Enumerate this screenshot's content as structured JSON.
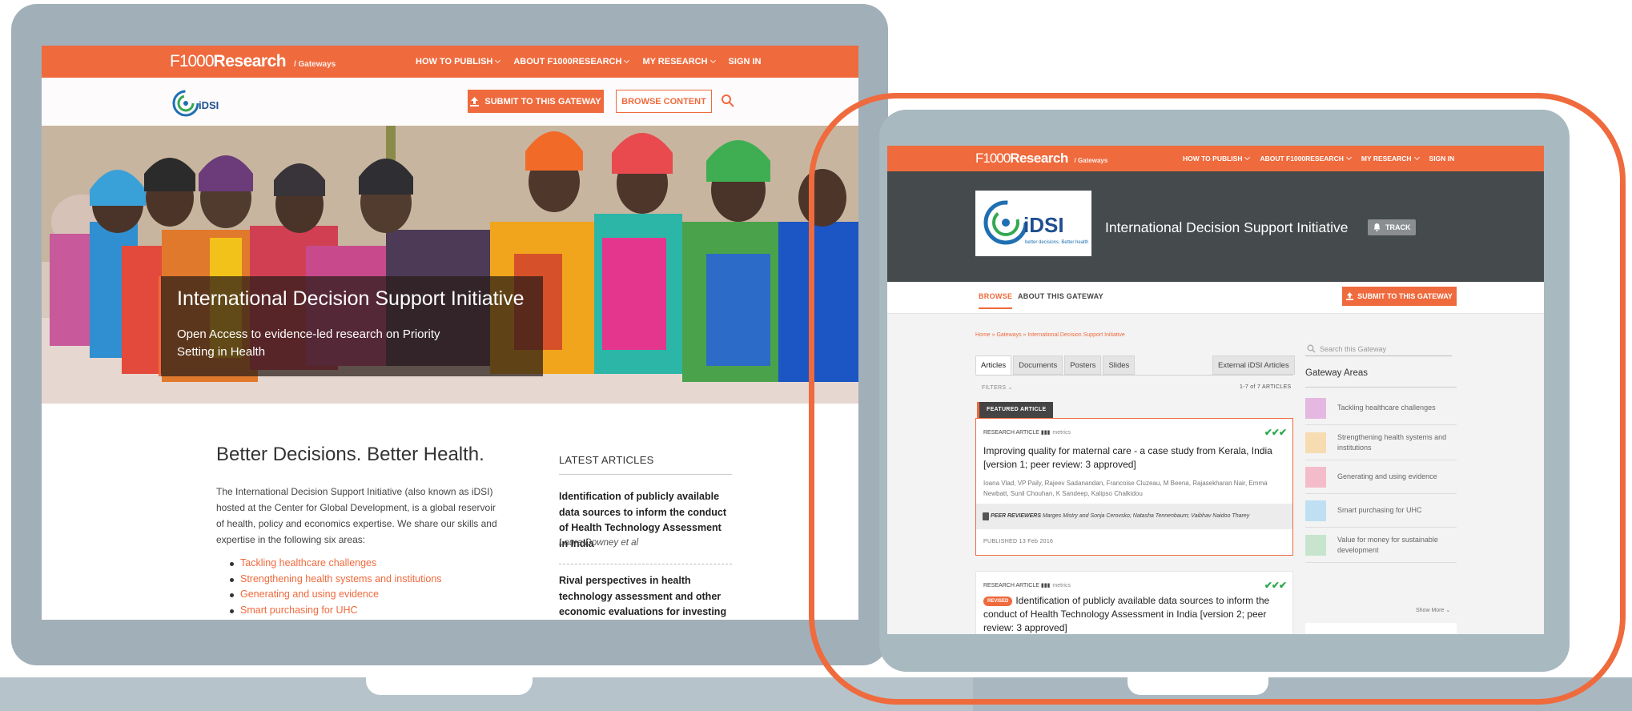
{
  "colors": {
    "brand_orange": "#ef6a3d",
    "dark_banner": "#454a4d",
    "device_gray": "#a1afb8",
    "peer_green": "#29a84a"
  },
  "header": {
    "logo_f1000": "F1000",
    "logo_research": "Research",
    "logo_gateways": "/ Gateways",
    "nav": [
      "HOW TO PUBLISH",
      "ABOUT F1000RESEARCH",
      "MY RESEARCH",
      "SIGN IN"
    ]
  },
  "screen1": {
    "submit_label": "SUBMIT TO THIS GATEWAY",
    "browse_label": "BROWSE CONTENT",
    "hero_title": "International Decision Support Initiative",
    "hero_subtitle": "Open Access to evidence-led research on Priority Setting in Health",
    "section_title": "Better Decisions. Better Health.",
    "intro": "The International Decision Support Initiative (also known as iDSI) hosted at the Center for Global Development, is a global reservoir of health, policy and economics expertise. We share our skills and expertise in the following six areas:",
    "areas": [
      "Tackling healthcare challenges",
      "Strengthening health systems and institutions",
      "Generating and using evidence",
      "Smart purchasing for UHC"
    ],
    "latest_heading": "LATEST ARTICLES",
    "latest": [
      {
        "title": "Identification of publicly available data sources to inform the conduct of Health Technology Assessment in India",
        "authors": "Laura Downey et al"
      },
      {
        "title": "Rival perspectives in health technology assessment and other economic evaluations for investing in global and"
      }
    ]
  },
  "screen2": {
    "logo_text": "iDSI",
    "logo_tagline": "better decisions. Better health",
    "gateway_title": "International Decision Support Initiative",
    "track_label": "TRACK",
    "tab_browse": "BROWSE",
    "tab_about": "ABOUT THIS GATEWAY",
    "submit_label": "SUBMIT TO THIS GATEWAY",
    "breadcrumb": "Home » Gateways » International Decision Support Initiative",
    "filter_tabs": [
      "Articles",
      "Documents",
      "Posters",
      "Slides"
    ],
    "external_tab": "External iDSI Articles",
    "filters_label": "FILTERS",
    "count_label": "1-7 of 7 ARTICLES",
    "featured_label": "FEATURED ARTICLE",
    "card1": {
      "type": "RESEARCH ARTICLE",
      "metrics": "metrics",
      "ticks": "✔✔✔",
      "title": "Improving quality for maternal care - a case study from Kerala, India [version 1; peer review: 3 approved]",
      "authors": "Ioana Vlad, VP Paily, Rajeev Sadanandan, Francoise Cluzeau, M Beena, Rajasekharan Nair, Emma Newbatt, Sunil Chouhan, K Sandeep, Kalipso Chalkidou",
      "peer_label": "PEER REVIEWERS",
      "peer_names": "Marges Mistry and Sonja Cerovsko; Natasha Tennenbaum; Vaibhav Naidoo Tharey",
      "published": "PUBLISHED 13 Feb 2016"
    },
    "card2": {
      "type": "RESEARCH ARTICLE",
      "metrics": "metrics",
      "ticks": "✔✔✔",
      "badge": "REVISED",
      "title": "Identification of publicly available data sources to inform the conduct of Health Technology Assessment in India [version 2; peer review: 3 approved]"
    },
    "search_placeholder": "Search this Gateway",
    "areas_heading": "Gateway Areas",
    "areas": [
      {
        "label": "Tackling healthcare challenges",
        "color": "#e4b8e0"
      },
      {
        "label": "Strengthening health systems and institutions",
        "color": "#f6dcb0"
      },
      {
        "label": "Generating and using evidence",
        "color": "#f4bccb"
      },
      {
        "label": "Smart purchasing for UHC",
        "color": "#bfe0f2"
      },
      {
        "label": "Value for money for sustainable development",
        "color": "#c7e5cc"
      }
    ],
    "show_more": "Show More"
  }
}
